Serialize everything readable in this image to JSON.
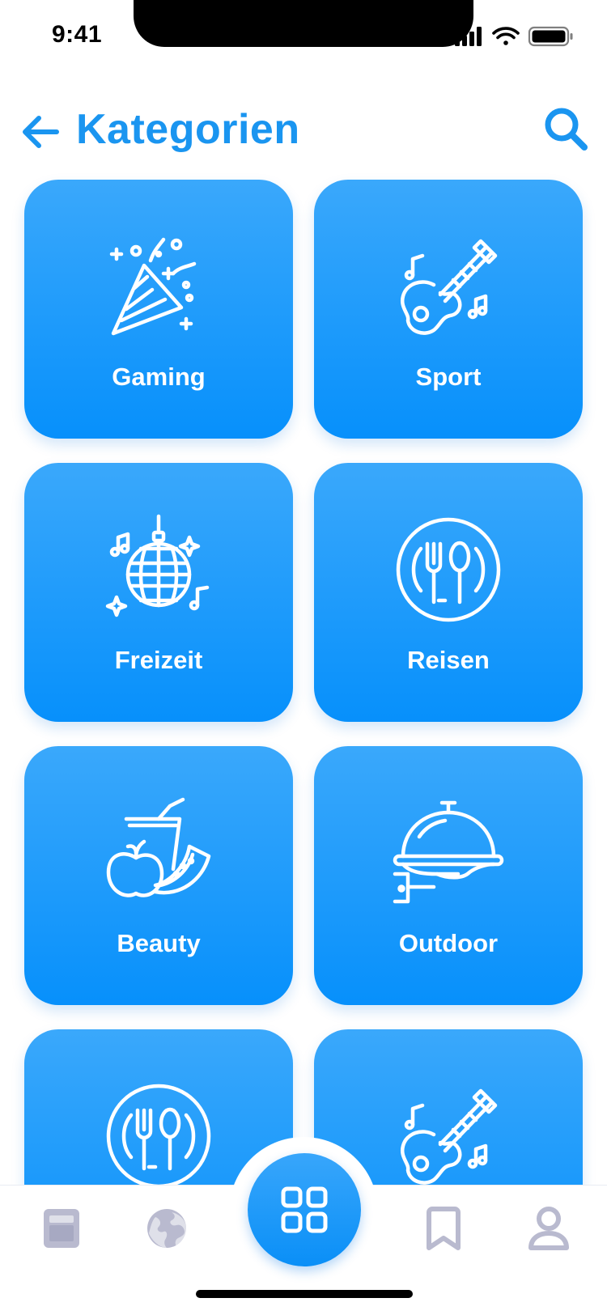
{
  "status": {
    "time": "9:41"
  },
  "header": {
    "title": "Kategorien"
  },
  "categories": [
    {
      "label": "Gaming",
      "icon": "party-popper-icon"
    },
    {
      "label": "Sport",
      "icon": "guitar-icon"
    },
    {
      "label": "Freizeit",
      "icon": "disco-ball-icon"
    },
    {
      "label": "Reisen",
      "icon": "plate-cutlery-icon"
    },
    {
      "label": "Beauty",
      "icon": "fruit-drink-icon"
    },
    {
      "label": "Outdoor",
      "icon": "cloche-serving-icon"
    },
    {
      "label": "",
      "icon": "plate-cutlery-icon"
    },
    {
      "label": "",
      "icon": "guitar-icon"
    }
  ],
  "tabbar": {
    "items": [
      "news-icon",
      "globe-icon",
      "categories-grid-icon",
      "bookmark-icon",
      "profile-icon"
    ],
    "active": "categories-grid-icon"
  },
  "colors": {
    "accent": "#1a95f0",
    "tile": "#1b98fb",
    "tab_inactive": "#b9bacf"
  }
}
